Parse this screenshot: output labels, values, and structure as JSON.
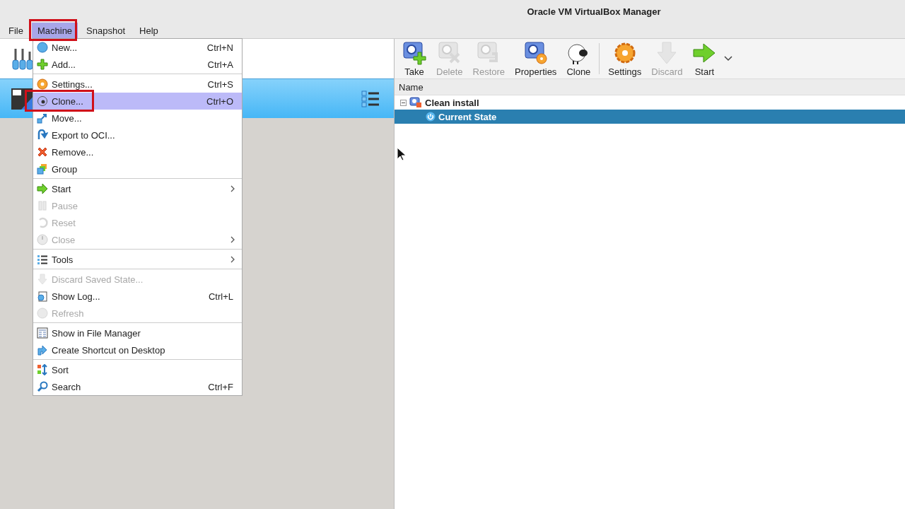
{
  "window": {
    "title": "Oracle VM VirtualBox Manager"
  },
  "menubar": [
    {
      "label": "File",
      "selected": false
    },
    {
      "label": "Machine",
      "selected": true
    },
    {
      "label": "Snapshot",
      "selected": false
    },
    {
      "label": "Help",
      "selected": false
    }
  ],
  "machine_menu": {
    "groups": [
      [
        {
          "label": "New...",
          "shortcut": "Ctrl+N",
          "disabled": false,
          "selected": false
        },
        {
          "label": "Add...",
          "shortcut": "Ctrl+A",
          "disabled": false,
          "selected": false
        }
      ],
      [
        {
          "label": "Settings...",
          "shortcut": "Ctrl+S",
          "disabled": false,
          "selected": false
        },
        {
          "label": "Clone...",
          "shortcut": "Ctrl+O",
          "disabled": false,
          "selected": true
        },
        {
          "label": "Move...",
          "disabled": false,
          "selected": false
        },
        {
          "label": "Export to OCI...",
          "disabled": false,
          "selected": false
        },
        {
          "label": "Remove...",
          "disabled": false,
          "selected": false
        },
        {
          "label": "Group",
          "disabled": false,
          "selected": false
        }
      ],
      [
        {
          "label": "Start",
          "submenu": true,
          "disabled": false,
          "selected": false
        },
        {
          "label": "Pause",
          "disabled": true,
          "selected": false
        },
        {
          "label": "Reset",
          "disabled": true,
          "selected": false
        },
        {
          "label": "Close",
          "submenu": true,
          "disabled": true,
          "selected": false
        }
      ],
      [
        {
          "label": "Tools",
          "submenu": true,
          "disabled": false,
          "selected": false
        }
      ],
      [
        {
          "label": "Discard Saved State...",
          "disabled": true,
          "selected": false
        },
        {
          "label": "Show Log...",
          "shortcut": "Ctrl+L",
          "disabled": false,
          "selected": false
        },
        {
          "label": "Refresh",
          "disabled": true,
          "selected": false
        }
      ],
      [
        {
          "label": "Show in File Manager",
          "disabled": false,
          "selected": false
        },
        {
          "label": "Create Shortcut on Desktop",
          "disabled": false,
          "selected": false
        }
      ],
      [
        {
          "label": "Sort",
          "disabled": false,
          "selected": false
        },
        {
          "label": "Search",
          "shortcut": "Ctrl+F",
          "disabled": false,
          "selected": false
        }
      ]
    ]
  },
  "snapshot_toolbar": [
    {
      "label": "Take",
      "disabled": false
    },
    {
      "label": "Delete",
      "disabled": true
    },
    {
      "label": "Restore",
      "disabled": true
    },
    {
      "label": "Properties",
      "disabled": false
    },
    {
      "label": "Clone",
      "disabled": false
    },
    {
      "label": "Settings",
      "disabled": false
    },
    {
      "label": "Discard",
      "disabled": true
    },
    {
      "label": "Start",
      "disabled": false
    }
  ],
  "snapshot_tree": {
    "columns": [
      "Name"
    ],
    "rows": [
      {
        "name": "Clean install",
        "expanded": true,
        "selected": false,
        "children": [
          {
            "name": "Current State",
            "selected": true
          }
        ]
      }
    ]
  }
}
